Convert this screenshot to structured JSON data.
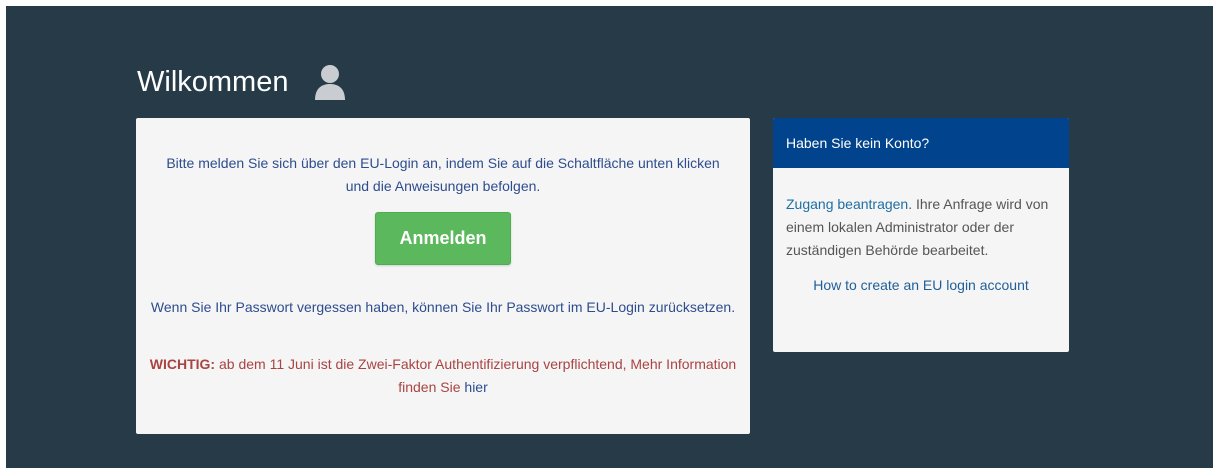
{
  "header": {
    "title": "Wilkommen",
    "user_icon": "user-icon"
  },
  "login": {
    "intro": "Bitte melden Sie sich über den EU-Login an, indem Sie auf die Schaltfläche unten klicken und die Anweisungen befolgen.",
    "button_label": "Anmelden",
    "forgot_prefix": "Wenn Sie Ihr Passwort vergessen haben, können Sie Ihr ",
    "forgot_link": "Passwort im EU-Login zurücksetzen",
    "forgot_suffix": ".",
    "important_label": "WICHTIG:",
    "important_text": " ab dem 11 Juni ist die Zwei-Faktor Authentifizierung verpflichtend, Mehr Information finden Sie ",
    "important_link": "hier"
  },
  "side": {
    "header": "Haben Sie kein Konto?",
    "request_link": "Zugang beantragen",
    "request_text": ". Ihre Anfrage wird von einem lokalen Administrator oder der zuständigen Behörde bearbeitet.",
    "howto_link": "How to create an EU login account"
  },
  "colors": {
    "background": "#263a47",
    "button": "#5cb85c",
    "side_header": "#01438c",
    "important": "#a94442"
  }
}
